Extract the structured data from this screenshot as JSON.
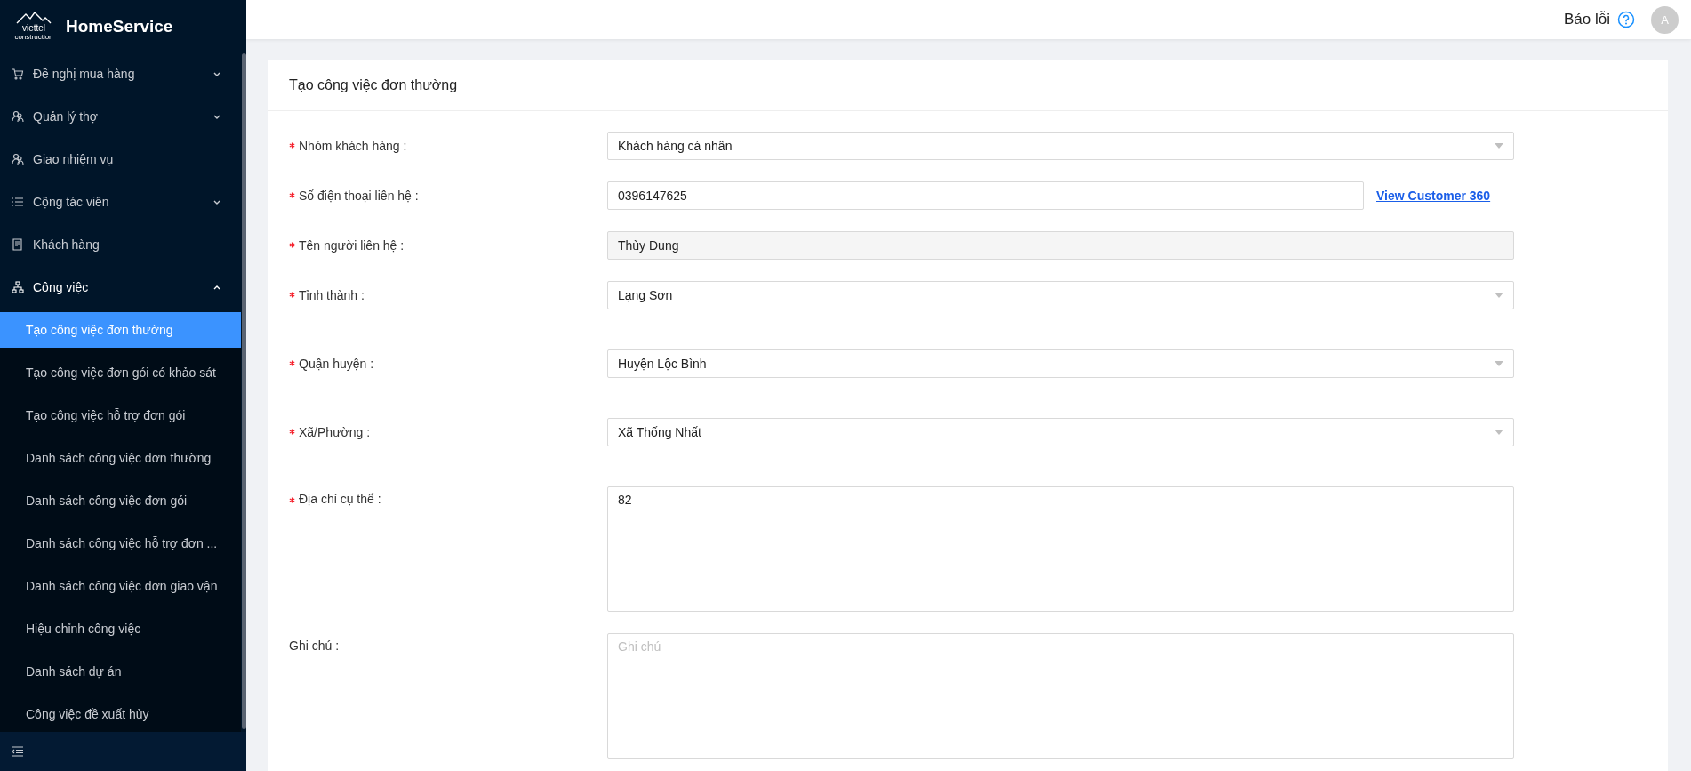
{
  "app": {
    "logo_word": "viettel",
    "logo_sub": "construction",
    "name": "HomeService"
  },
  "sidebar": {
    "items": [
      {
        "label": "Đề nghị mua hàng",
        "expandable": true,
        "expanded": false
      },
      {
        "label": "Quản lý thợ",
        "expandable": true,
        "expanded": false
      },
      {
        "label": "Giao nhiệm vụ",
        "expandable": false,
        "expanded": false
      },
      {
        "label": "Cộng tác viên",
        "expandable": true,
        "expanded": false
      },
      {
        "label": "Khách hàng",
        "expandable": false,
        "expanded": false
      },
      {
        "label": "Công việc",
        "expandable": true,
        "expanded": true,
        "children": [
          {
            "label": "Tạo công việc đơn thường",
            "selected": true
          },
          {
            "label": "Tạo công việc đơn gói có khảo sát",
            "selected": false
          },
          {
            "label": "Tạo công việc hỗ trợ đơn gói",
            "selected": false
          },
          {
            "label": "Danh sách công việc đơn thường",
            "selected": false
          },
          {
            "label": "Danh sách công việc đơn gói",
            "selected": false
          },
          {
            "label": "Danh sách công việc hỗ trợ đơn ...",
            "selected": false
          },
          {
            "label": "Danh sách công việc đơn giao vận",
            "selected": false
          },
          {
            "label": "Hiệu chỉnh công việc",
            "selected": false
          },
          {
            "label": "Danh sách dự án",
            "selected": false
          },
          {
            "label": "Công việc đề xuất hủy",
            "selected": false
          }
        ]
      }
    ]
  },
  "header": {
    "report": "Báo lỗi",
    "avatar": "A"
  },
  "form": {
    "title": "Tạo công việc đơn thường",
    "fields": [
      {
        "kind": "select",
        "label": "Nhóm khách hàng :",
        "required": true,
        "value": "Khách hàng cá nhân"
      },
      {
        "kind": "input",
        "label": "Số điện thoại liên hệ :",
        "required": true,
        "value": "0396147625",
        "link": "View Customer 360"
      },
      {
        "kind": "readonly",
        "label": "Tên người liên hệ :",
        "required": true,
        "value": "Thùy Dung"
      },
      {
        "kind": "select",
        "label": "Tỉnh thành :",
        "required": true,
        "value": "Lạng Sơn"
      },
      {
        "kind": "select",
        "label": "Quận huyện :",
        "required": true,
        "value": "Huyện Lộc Bình"
      },
      {
        "kind": "select",
        "label": "Xã/Phường :",
        "required": true,
        "value": "Xã Thống Nhất"
      },
      {
        "kind": "textarea",
        "label": "Địa chỉ cụ thể :",
        "required": true,
        "value": "82"
      },
      {
        "kind": "textarea",
        "label": "Ghi chú :",
        "required": false,
        "placeholder": "Ghi chú"
      }
    ]
  }
}
